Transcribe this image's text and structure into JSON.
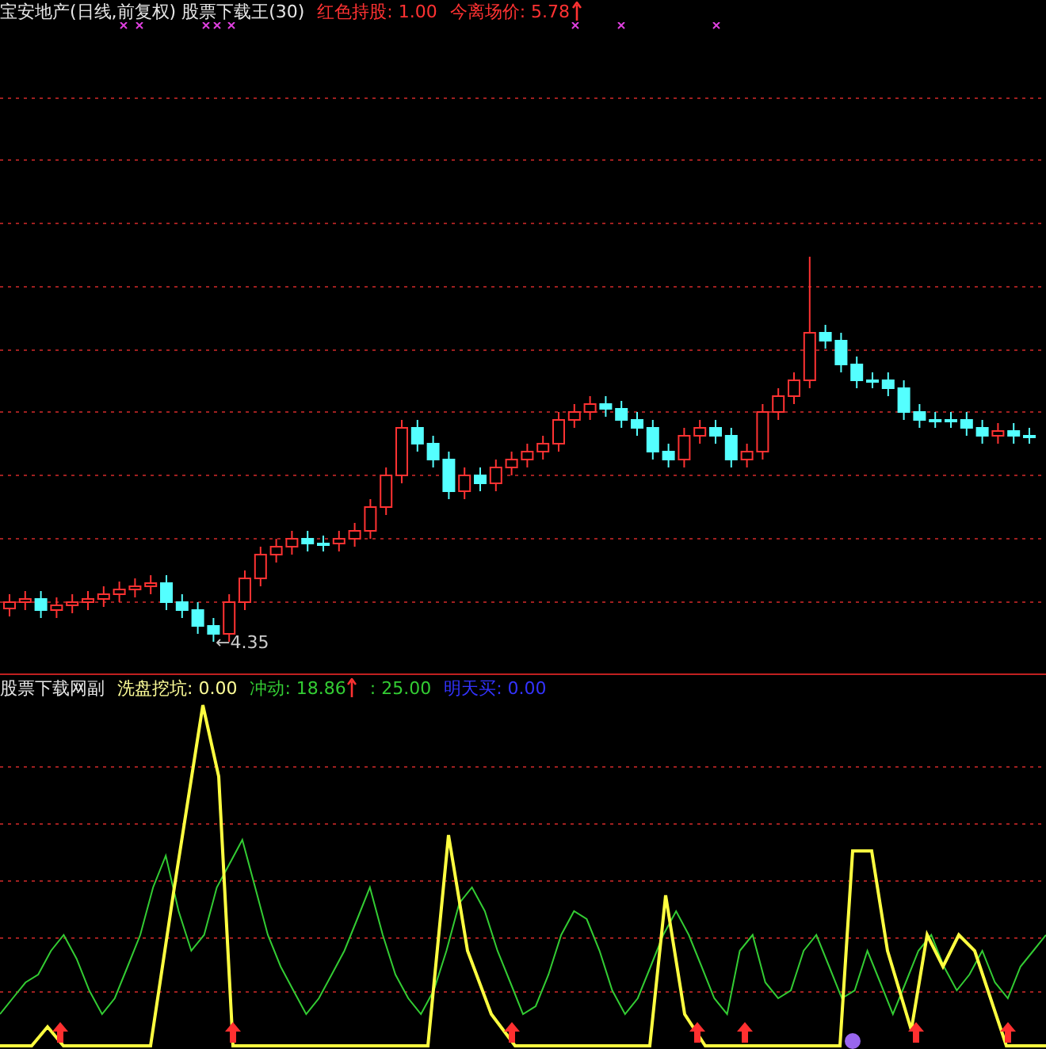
{
  "price_panel": {
    "title": "宝安地产(日线,前复权) 股票下载王(30)",
    "indicators": [
      {
        "label": "红色持股: 1.00",
        "color": "#ff3232",
        "rising": false
      },
      {
        "label": "今离场价: 5.78",
        "color": "#ff3232",
        "rising": true
      }
    ],
    "low_label": "←4.35"
  },
  "indicator_panel": {
    "title": "股票下载网副",
    "indicators": [
      {
        "label": "洗盘挖坑: 0.00",
        "color": "#ffff99",
        "rising": false
      },
      {
        "label": "冲动: 18.86",
        "color": "#33cc33",
        "rising": true
      },
      {
        "label": ": 25.00",
        "color": "#33cc33",
        "rising": false
      },
      {
        "label": "明天买: 0.00",
        "color": "#3333ff",
        "rising": false
      }
    ]
  }
}
